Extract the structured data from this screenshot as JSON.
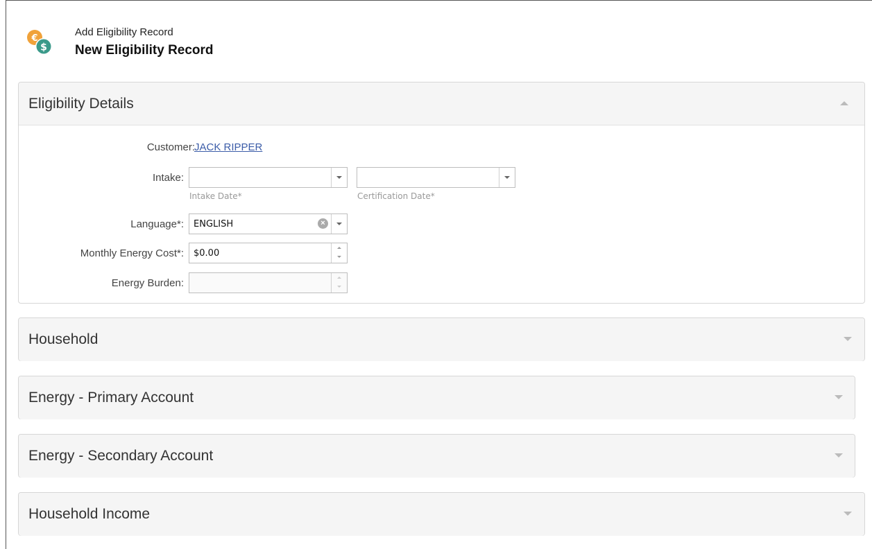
{
  "header": {
    "subtitle": "Add Eligibility Record",
    "title": "New Eligibility Record",
    "icon": "coins-euro-dollar-icon"
  },
  "eligibility": {
    "title": "Eligibility Details",
    "customer_label": "Customer:",
    "customer_name": "JACK RIPPER",
    "intake_label": "Intake:",
    "intake_date_value": "",
    "intake_date_hint": "Intake Date*",
    "certification_date_value": "",
    "certification_date_hint": "Certification Date*",
    "language_label": "Language*:",
    "language_value": "ENGLISH",
    "monthly_cost_label": "Monthly Energy Cost*:",
    "monthly_cost_value": "$0.00",
    "energy_burden_label": "Energy Burden:",
    "energy_burden_value": ""
  },
  "sections": [
    {
      "title": "Household"
    },
    {
      "title": "Energy - Primary Account"
    },
    {
      "title": "Energy - Secondary Account"
    },
    {
      "title": "Household Income"
    }
  ],
  "colors": {
    "link": "#3b5ca8",
    "panel_header_bg": "#f5f5f5",
    "icon_orange": "#f0a23a",
    "icon_teal": "#3a9a8a"
  }
}
